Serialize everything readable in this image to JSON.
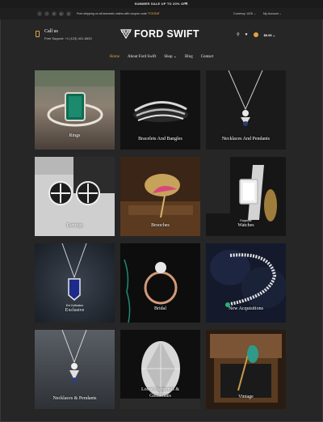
{
  "announcement": {
    "text": "SUMMER SALE UP TO 20% OFF.",
    "close": "×"
  },
  "utility": {
    "socials": [
      "t",
      "f",
      "in",
      "g+",
      "p"
    ],
    "promo_text": "Free shipping on all domestic orders with coupon code",
    "promo_code": "\"FOOD8\"",
    "currency_label": "Currency:",
    "currency_value": "USD ⌄",
    "account_label": "My Account ⌄"
  },
  "header": {
    "call_title": "Call us",
    "call_sub": "Free Support: +1 (123) 401-6533",
    "brand": "FORD SWIFT",
    "search_icon": "⚲",
    "wishlist_icon": "♥",
    "cart_total": "$0.00 ⌄"
  },
  "nav": {
    "items": [
      "Home",
      "About Ford Swift",
      "Shop ⌄",
      "Blog",
      "Contact"
    ]
  },
  "categories": [
    {
      "label": "Rings",
      "pre": ""
    },
    {
      "label": "Bracelets And Bangles",
      "pre": ""
    },
    {
      "label": "Necklaces And Pendants",
      "pre": ""
    },
    {
      "label": "Earrings",
      "pre": ""
    },
    {
      "label": "Brooches",
      "pre": ""
    },
    {
      "label": "Watches",
      "pre": "Exquisite"
    },
    {
      "label": "Exclusive",
      "pre": "Ext Collection"
    },
    {
      "label": "Bridal",
      "pre": ""
    },
    {
      "label": "New Acquisitions",
      "pre": ""
    },
    {
      "label": "Necklaces & Pendants",
      "pre": ""
    },
    {
      "label": "Loose Diamonds & Gemstones",
      "pre": ""
    },
    {
      "label": "Vintage",
      "pre": ""
    }
  ]
}
